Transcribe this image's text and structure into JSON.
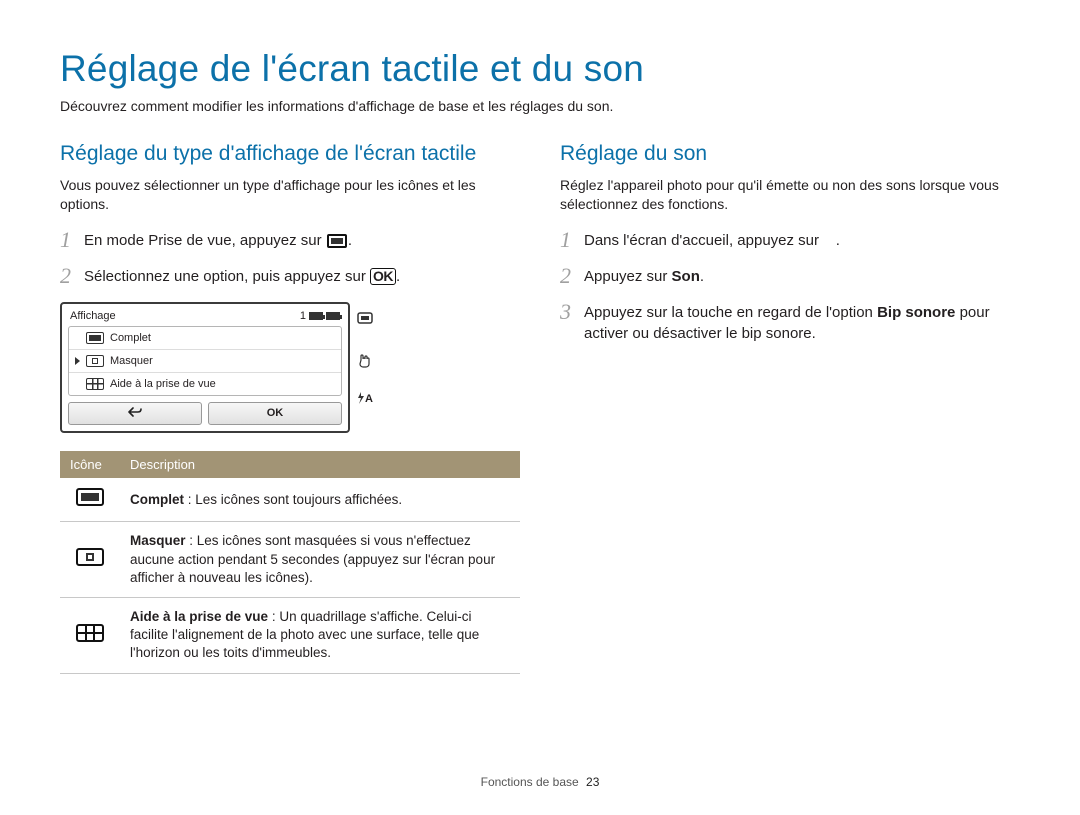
{
  "title": "Réglage de l'écran tactile et du son",
  "subtitle": "Découvrez comment modifier les informations d'affichage de base et les réglages du son.",
  "left": {
    "heading": "Réglage du type d'affichage de l'écran tactile",
    "intro": "Vous pouvez sélectionner un type d'affichage pour les icônes et les options.",
    "step1": "En mode Prise de vue, appuyez sur ",
    "step2": "Sélectionnez une option, puis appuyez sur ",
    "ok_label": "OK",
    "screen": {
      "header_title": "Affichage",
      "count": "1",
      "items": {
        "complet": "Complet",
        "masquer": "Masquer",
        "aide": "Aide à la prise de vue"
      },
      "btn_ok": "OK"
    },
    "table": {
      "col_icon": "Icône",
      "col_desc": "Description",
      "row1_bold": "Complet",
      "row1_rest": " : Les icônes sont toujours affichées.",
      "row2_bold": "Masquer",
      "row2_rest": " : Les icônes sont masquées si vous n'effectuez aucune action pendant 5 secondes (appuyez sur l'écran pour afficher à nouveau les icônes).",
      "row3_bold": "Aide à la prise de vue",
      "row3_rest": " : Un quadrillage s'affiche. Celui-ci facilite l'alignement de la photo avec une surface, telle que l'horizon ou les toits d'immeubles."
    }
  },
  "right": {
    "heading": "Réglage du son",
    "intro": "Réglez l'appareil photo pour qu'il émette ou non des sons lorsque vous sélectionnez des fonctions.",
    "step1": "Dans l'écran d'accueil, appuyez sur ",
    "step2_pre": "Appuyez sur ",
    "step2_bold": "Son",
    "step2_post": ".",
    "step3_pre": "Appuyez sur la touche en regard de l'option ",
    "step3_bold": "Bip sonore",
    "step3_post": " pour activer ou désactiver le bip sonore."
  },
  "footer": {
    "section": "Fonctions de base",
    "page": "23"
  }
}
